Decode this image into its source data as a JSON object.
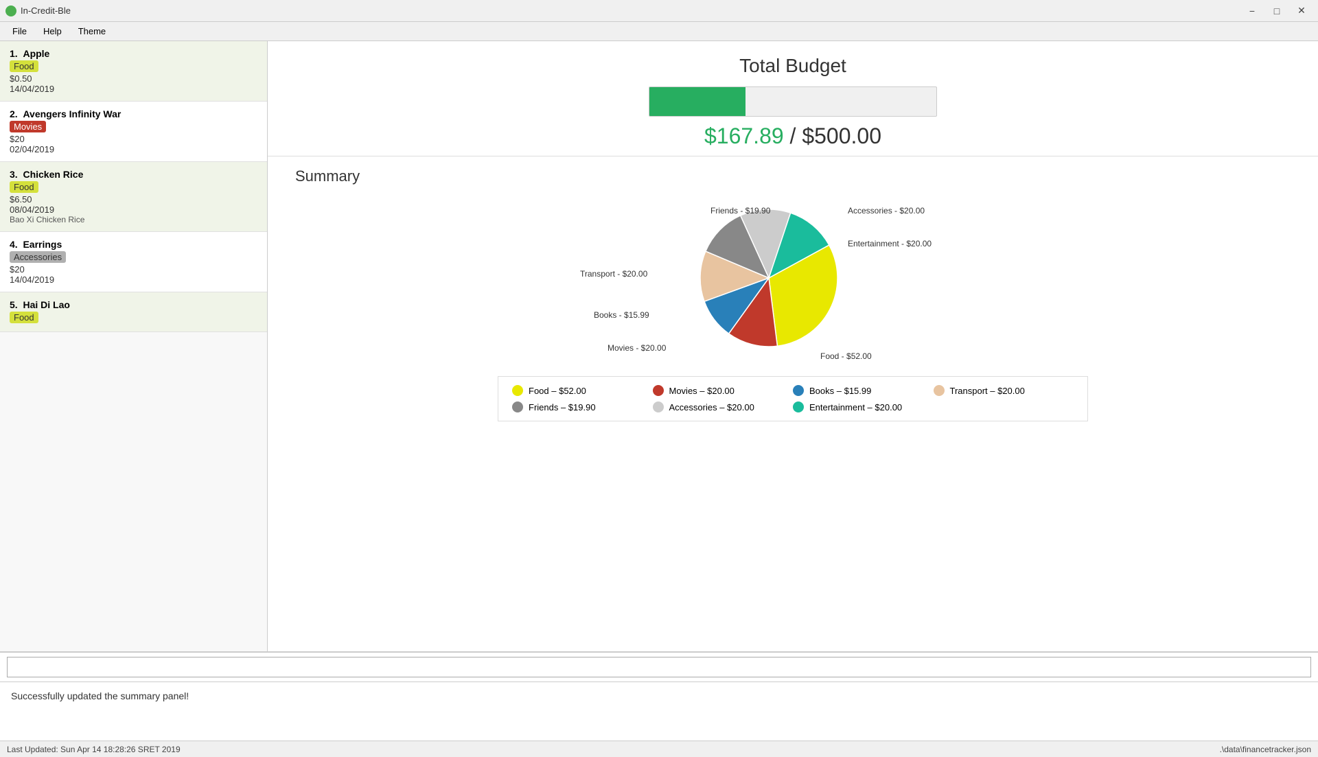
{
  "app": {
    "title": "In-Credit-Ble",
    "icon_color": "#4CAF50"
  },
  "titlebar": {
    "minimize": "−",
    "maximize": "□",
    "close": "✕"
  },
  "menubar": {
    "items": [
      "File",
      "Help",
      "Theme"
    ]
  },
  "transactions": [
    {
      "number": "1.",
      "name": "Apple",
      "category": "Food",
      "cat_class": "cat-food",
      "amount": "$0.50",
      "date": "14/04/2019",
      "note": "",
      "bg": "green"
    },
    {
      "number": "2.",
      "name": "Avengers Infinity War",
      "category": "Movies",
      "cat_class": "cat-movies",
      "amount": "$20",
      "date": "02/04/2019",
      "note": "",
      "bg": "white"
    },
    {
      "number": "3.",
      "name": "Chicken Rice",
      "category": "Food",
      "cat_class": "cat-food",
      "amount": "$6.50",
      "date": "08/04/2019",
      "note": "Bao Xi Chicken Rice",
      "bg": "green"
    },
    {
      "number": "4.",
      "name": "Earrings",
      "category": "Accessories",
      "cat_class": "cat-accessories",
      "amount": "$20",
      "date": "14/04/2019",
      "note": "",
      "bg": "white"
    },
    {
      "number": "5.",
      "name": "Hai Di Lao",
      "category": "Food",
      "cat_class": "cat-food",
      "amount": "",
      "date": "",
      "note": "",
      "bg": "green"
    }
  ],
  "budget": {
    "title": "Total Budget",
    "spent": "$167.89",
    "total": "$500.00",
    "separator": "/",
    "percent": 33.578
  },
  "summary": {
    "title": "Summary",
    "categories": [
      {
        "name": "Food",
        "amount": "$52.00",
        "color": "#e8e800",
        "value": 52
      },
      {
        "name": "Movies",
        "amount": "$20.00",
        "color": "#c0392b",
        "value": 20
      },
      {
        "name": "Books",
        "amount": "$15.99",
        "color": "#2980b9",
        "value": 15.99
      },
      {
        "name": "Transport",
        "amount": "$20.00",
        "color": "#e8c4a0",
        "value": 20
      },
      {
        "name": "Friends",
        "amount": "$19.90",
        "color": "#888888",
        "value": 19.9
      },
      {
        "name": "Accessories",
        "amount": "$20.00",
        "color": "#cccccc",
        "value": 20
      },
      {
        "name": "Entertainment",
        "amount": "$20.00",
        "color": "#1abc9c",
        "value": 20
      }
    ]
  },
  "input": {
    "placeholder": ""
  },
  "status": {
    "message": "Successfully updated the summary panel!"
  },
  "footer": {
    "last_updated": "Last Updated: Sun Apr 14 18:28:26 SRET 2019",
    "file_path": ".\\data\\financetracker.json"
  }
}
